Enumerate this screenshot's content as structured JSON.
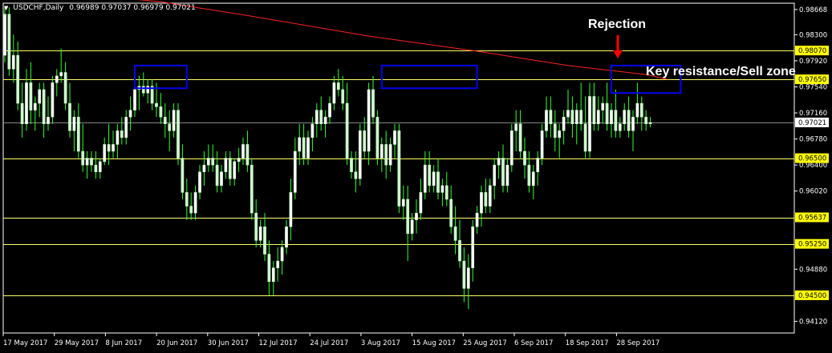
{
  "header": {
    "symbol_timeframe": "USDCHF,Daily",
    "ohlc": "0.96989 0.97037 0.96979 0.97021"
  },
  "annotations": {
    "rejection": "Rejection",
    "resistance": "Key resistance/Sell zone"
  },
  "colors": {
    "background": "#000000",
    "candle_up": "#ffffff",
    "candle_down": "#ccffcc",
    "wick": "#33ff33",
    "axis": "#ffffff",
    "level_line": "#ffff66",
    "level_label_bg": "#ffff00",
    "ma": "#ff2222",
    "zone_box": "#0000ee",
    "arrow": "#ff0000",
    "current_price_line": "#888888"
  },
  "chart_data": {
    "type": "candlestick",
    "title": "USDCHF,Daily",
    "ylim": [
      0.9395,
      0.9876
    ],
    "y_ticks": [
      "0.98668",
      "0.98300",
      "0.97920",
      "0.97540",
      "0.97160",
      "0.96780",
      "0.96400",
      "0.96020",
      "0.94880",
      "0.94120"
    ],
    "x_labels": [
      "17 May 2017",
      "29 May 2017",
      "8 Jun 2017",
      "20 Jun 2017",
      "30 Jun 2017",
      "12 Jul 2017",
      "24 Jul 2017",
      "3 Aug 2017",
      "15 Aug 2017",
      "25 Aug 2017",
      "6 Sep 2017",
      "18 Sep 2017",
      "28 Sep 2017"
    ],
    "levels": [
      {
        "value": 0.9807,
        "label": "0.98070"
      },
      {
        "value": 0.9765,
        "label": "0.97650"
      },
      {
        "value": 0.965,
        "label": "0.96500"
      },
      {
        "value": 0.95637,
        "label": "0.95637"
      },
      {
        "value": 0.9525,
        "label": "0.95250"
      },
      {
        "value": 0.945,
        "label": "0.94500"
      }
    ],
    "current_price": {
      "value": 0.97021,
      "label": "0.97021"
    },
    "moving_average": [
      [
        0,
        0.99
      ],
      [
        36,
        0.9878
      ],
      [
        56,
        0.9858
      ],
      [
        84,
        0.9828
      ],
      [
        110,
        0.9805
      ],
      [
        130,
        0.9785
      ],
      [
        148,
        0.9772
      ],
      [
        153,
        0.9765
      ]
    ],
    "zones": [
      {
        "x": [
          30,
          42
        ],
        "y": [
          0.9752,
          0.9785
        ]
      },
      {
        "x": [
          87,
          109
        ],
        "y": [
          0.9752,
          0.9785
        ]
      },
      {
        "x": [
          140,
          156
        ],
        "y": [
          0.9745,
          0.9785
        ]
      }
    ],
    "candles": [
      [
        0.98,
        0.987,
        0.979,
        0.986
      ],
      [
        0.986,
        0.987,
        0.977,
        0.978
      ],
      [
        0.978,
        0.983,
        0.976,
        0.98
      ],
      [
        0.98,
        0.982,
        0.972,
        0.973
      ],
      [
        0.973,
        0.976,
        0.968,
        0.97
      ],
      [
        0.97,
        0.978,
        0.969,
        0.976
      ],
      [
        0.976,
        0.979,
        0.97,
        0.972
      ],
      [
        0.972,
        0.974,
        0.969,
        0.973
      ],
      [
        0.973,
        0.976,
        0.971,
        0.975
      ],
      [
        0.975,
        0.976,
        0.968,
        0.97
      ],
      [
        0.97,
        0.974,
        0.969,
        0.971
      ],
      [
        0.971,
        0.977,
        0.97,
        0.976
      ],
      [
        0.976,
        0.978,
        0.974,
        0.977
      ],
      [
        0.977,
        0.981,
        0.976,
        0.9775
      ],
      [
        0.9775,
        0.979,
        0.972,
        0.973
      ],
      [
        0.973,
        0.976,
        0.968,
        0.969
      ],
      [
        0.969,
        0.972,
        0.966,
        0.971
      ],
      [
        0.971,
        0.973,
        0.965,
        0.966
      ],
      [
        0.966,
        0.97,
        0.963,
        0.964
      ],
      [
        0.964,
        0.966,
        0.962,
        0.965
      ],
      [
        0.965,
        0.966,
        0.963,
        0.964
      ],
      [
        0.964,
        0.966,
        0.962,
        0.963
      ],
      [
        0.963,
        0.965,
        0.962,
        0.9645
      ],
      [
        0.9645,
        0.968,
        0.964,
        0.967
      ],
      [
        0.967,
        0.97,
        0.964,
        0.966
      ],
      [
        0.966,
        0.969,
        0.965,
        0.967
      ],
      [
        0.967,
        0.97,
        0.965,
        0.969
      ],
      [
        0.969,
        0.971,
        0.967,
        0.968
      ],
      [
        0.968,
        0.972,
        0.967,
        0.971
      ],
      [
        0.971,
        0.974,
        0.969,
        0.972
      ],
      [
        0.972,
        0.976,
        0.971,
        0.975
      ],
      [
        0.975,
        0.977,
        0.972,
        0.9755
      ],
      [
        0.9755,
        0.9775,
        0.974,
        0.9745
      ],
      [
        0.9745,
        0.9765,
        0.973,
        0.9755
      ],
      [
        0.9755,
        0.9765,
        0.972,
        0.973
      ],
      [
        0.973,
        0.976,
        0.971,
        0.9725
      ],
      [
        0.9725,
        0.9745,
        0.97,
        0.971
      ],
      [
        0.971,
        0.973,
        0.968,
        0.97
      ],
      [
        0.97,
        0.972,
        0.966,
        0.969
      ],
      [
        0.969,
        0.973,
        0.968,
        0.972
      ],
      [
        0.972,
        0.973,
        0.964,
        0.965
      ],
      [
        0.965,
        0.967,
        0.959,
        0.96
      ],
      [
        0.96,
        0.962,
        0.956,
        0.958
      ],
      [
        0.958,
        0.96,
        0.956,
        0.957
      ],
      [
        0.957,
        0.961,
        0.956,
        0.96
      ],
      [
        0.96,
        0.964,
        0.959,
        0.963
      ],
      [
        0.963,
        0.966,
        0.961,
        0.964
      ],
      [
        0.964,
        0.967,
        0.963,
        0.965
      ],
      [
        0.965,
        0.967,
        0.963,
        0.964
      ],
      [
        0.964,
        0.966,
        0.96,
        0.961
      ],
      [
        0.961,
        0.964,
        0.96,
        0.963
      ],
      [
        0.963,
        0.966,
        0.962,
        0.965
      ],
      [
        0.965,
        0.966,
        0.961,
        0.962
      ],
      [
        0.962,
        0.965,
        0.961,
        0.9645
      ],
      [
        0.9645,
        0.9665,
        0.963,
        0.965
      ],
      [
        0.965,
        0.968,
        0.964,
        0.967
      ],
      [
        0.967,
        0.969,
        0.963,
        0.964
      ],
      [
        0.964,
        0.965,
        0.956,
        0.957
      ],
      [
        0.957,
        0.959,
        0.952,
        0.953
      ],
      [
        0.953,
        0.956,
        0.952,
        0.955
      ],
      [
        0.955,
        0.957,
        0.95,
        0.951
      ],
      [
        0.951,
        0.953,
        0.945,
        0.947
      ],
      [
        0.947,
        0.95,
        0.945,
        0.949
      ],
      [
        0.949,
        0.952,
        0.947,
        0.95
      ],
      [
        0.95,
        0.953,
        0.948,
        0.952
      ],
      [
        0.952,
        0.956,
        0.951,
        0.955
      ],
      [
        0.955,
        0.962,
        0.953,
        0.96
      ],
      [
        0.96,
        0.968,
        0.959,
        0.966
      ],
      [
        0.966,
        0.97,
        0.964,
        0.968
      ],
      [
        0.968,
        0.97,
        0.964,
        0.965
      ],
      [
        0.965,
        0.969,
        0.964,
        0.968
      ],
      [
        0.968,
        0.971,
        0.966,
        0.97
      ],
      [
        0.97,
        0.973,
        0.968,
        0.972
      ],
      [
        0.972,
        0.974,
        0.969,
        0.97
      ],
      [
        0.97,
        0.972,
        0.968,
        0.971
      ],
      [
        0.971,
        0.974,
        0.97,
        0.973
      ],
      [
        0.973,
        0.977,
        0.972,
        0.976
      ],
      [
        0.976,
        0.978,
        0.974,
        0.975
      ],
      [
        0.975,
        0.977,
        0.972,
        0.973
      ],
      [
        0.973,
        0.976,
        0.964,
        0.965
      ],
      [
        0.965,
        0.966,
        0.962,
        0.963
      ],
      [
        0.963,
        0.966,
        0.96,
        0.962
      ],
      [
        0.962,
        0.97,
        0.961,
        0.969
      ],
      [
        0.969,
        0.971,
        0.965,
        0.966
      ],
      [
        0.966,
        0.976,
        0.964,
        0.975
      ],
      [
        0.975,
        0.977,
        0.97,
        0.971
      ],
      [
        0.971,
        0.972,
        0.964,
        0.965
      ],
      [
        0.965,
        0.968,
        0.963,
        0.967
      ],
      [
        0.967,
        0.969,
        0.962,
        0.964
      ],
      [
        0.964,
        0.968,
        0.963,
        0.967
      ],
      [
        0.967,
        0.97,
        0.965,
        0.969
      ],
      [
        0.969,
        0.97,
        0.957,
        0.958
      ],
      [
        0.958,
        0.961,
        0.956,
        0.959
      ],
      [
        0.959,
        0.961,
        0.95,
        0.954
      ],
      [
        0.954,
        0.957,
        0.953,
        0.956
      ],
      [
        0.956,
        0.959,
        0.954,
        0.957
      ],
      [
        0.957,
        0.962,
        0.956,
        0.96
      ],
      [
        0.96,
        0.966,
        0.959,
        0.964
      ],
      [
        0.964,
        0.966,
        0.96,
        0.961
      ],
      [
        0.961,
        0.964,
        0.96,
        0.963
      ],
      [
        0.963,
        0.965,
        0.959,
        0.96
      ],
      [
        0.96,
        0.962,
        0.958,
        0.961
      ],
      [
        0.961,
        0.963,
        0.958,
        0.959
      ],
      [
        0.959,
        0.961,
        0.954,
        0.955
      ],
      [
        0.955,
        0.958,
        0.951,
        0.953
      ],
      [
        0.953,
        0.956,
        0.949,
        0.95
      ],
      [
        0.95,
        0.952,
        0.944,
        0.946
      ],
      [
        0.946,
        0.951,
        0.943,
        0.949
      ],
      [
        0.949,
        0.956,
        0.947,
        0.955
      ],
      [
        0.955,
        0.958,
        0.954,
        0.957
      ],
      [
        0.957,
        0.961,
        0.955,
        0.96
      ],
      [
        0.96,
        0.962,
        0.957,
        0.958
      ],
      [
        0.958,
        0.962,
        0.957,
        0.961
      ],
      [
        0.961,
        0.965,
        0.959,
        0.964
      ],
      [
        0.964,
        0.966,
        0.962,
        0.965
      ],
      [
        0.965,
        0.967,
        0.96,
        0.961
      ],
      [
        0.961,
        0.965,
        0.96,
        0.964
      ],
      [
        0.964,
        0.97,
        0.963,
        0.969
      ],
      [
        0.969,
        0.972,
        0.966,
        0.97
      ],
      [
        0.97,
        0.972,
        0.965,
        0.966
      ],
      [
        0.966,
        0.968,
        0.962,
        0.964
      ],
      [
        0.964,
        0.966,
        0.96,
        0.961
      ],
      [
        0.961,
        0.964,
        0.959,
        0.963
      ],
      [
        0.963,
        0.966,
        0.961,
        0.965
      ],
      [
        0.965,
        0.97,
        0.964,
        0.969
      ],
      [
        0.969,
        0.974,
        0.968,
        0.972
      ],
      [
        0.972,
        0.974,
        0.968,
        0.97
      ],
      [
        0.97,
        0.972,
        0.966,
        0.968
      ],
      [
        0.968,
        0.97,
        0.965,
        0.969
      ],
      [
        0.969,
        0.972,
        0.967,
        0.971
      ],
      [
        0.971,
        0.975,
        0.97,
        0.972
      ],
      [
        0.972,
        0.974,
        0.968,
        0.97
      ],
      [
        0.97,
        0.973,
        0.967,
        0.972
      ],
      [
        0.972,
        0.976,
        0.969,
        0.97
      ],
      [
        0.97,
        0.974,
        0.965,
        0.966
      ],
      [
        0.966,
        0.976,
        0.965,
        0.974
      ],
      [
        0.974,
        0.976,
        0.969,
        0.97
      ],
      [
        0.97,
        0.974,
        0.969,
        0.972
      ],
      [
        0.972,
        0.974,
        0.97,
        0.973
      ],
      [
        0.973,
        0.976,
        0.969,
        0.97
      ],
      [
        0.97,
        0.973,
        0.968,
        0.972
      ],
      [
        0.972,
        0.975,
        0.968,
        0.969
      ],
      [
        0.969,
        0.971,
        0.968,
        0.97
      ],
      [
        0.97,
        0.973,
        0.969,
        0.972
      ],
      [
        0.972,
        0.974,
        0.968,
        0.969
      ],
      [
        0.969,
        0.972,
        0.966,
        0.971
      ],
      [
        0.971,
        0.976,
        0.97,
        0.973
      ],
      [
        0.973,
        0.974,
        0.969,
        0.971
      ],
      [
        0.971,
        0.972,
        0.969,
        0.97
      ],
      [
        0.97,
        0.971,
        0.9695,
        0.9702
      ]
    ]
  }
}
